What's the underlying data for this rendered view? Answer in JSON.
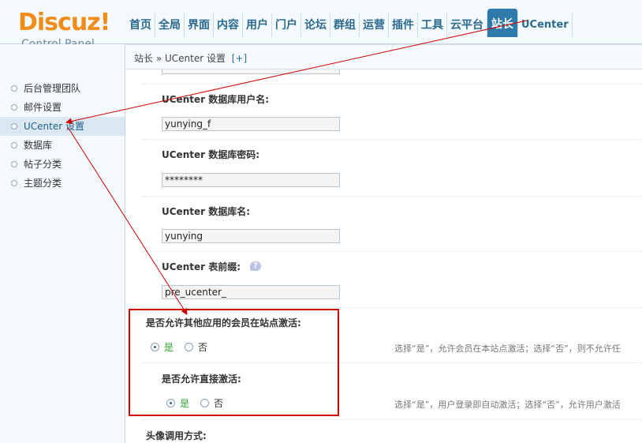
{
  "header": {
    "logo_text": "Discuz!",
    "logo_subtitle": "Control Panel",
    "nav": [
      "首页",
      "全局",
      "界面",
      "内容",
      "用户",
      "门户",
      "论坛",
      "群组",
      "运营",
      "插件",
      "工具",
      "云平台",
      "站长",
      "UCenter"
    ],
    "active_nav": "站长"
  },
  "sidebar": {
    "items": [
      "后台管理团队",
      "邮件设置",
      "UCenter 设置",
      "数据库",
      "帖子分类",
      "主题分类"
    ],
    "active": "UCenter 设置"
  },
  "breadcrumb": {
    "text": "站长 » UCenter 设置",
    "expand": "[+]"
  },
  "form": {
    "db_user_label": "UCenter 数据库用户名:",
    "db_user_value": "yunying_f",
    "db_password_label": "UCenter 数据库密码:",
    "db_password_value": "********",
    "db_name_label": "UCenter 数据库名:",
    "db_name_value": "yunying",
    "table_prefix_label": "UCenter 表前缀:",
    "table_prefix_value": "pre_ucenter_",
    "allow_other_activate_label": "是否允许其他应用的会员在站点激活:",
    "allow_other_activate_yes": "是",
    "allow_other_activate_no": "否",
    "allow_other_activate_hint": "选择“是”，允许会员在本站点激活；选择“否”，则不允许任",
    "allow_direct_activate_label": "是否允许直接激活:",
    "allow_direct_activate_yes": "是",
    "allow_direct_activate_no": "否",
    "allow_direct_activate_hint": "选择“是”，用户登录即自动激活；选择“否”，允许用户激活",
    "avatar_method_label": "头像调用方式:"
  },
  "colors": {
    "accent": "#2e7bab",
    "logo": "#f08c1a",
    "annotation": "#d00000"
  }
}
